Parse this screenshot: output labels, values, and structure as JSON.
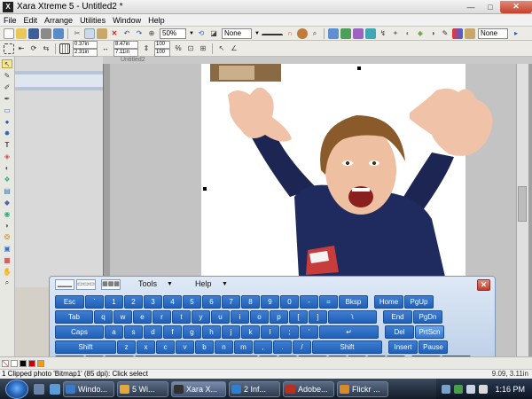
{
  "window": {
    "title": "Xara Xtreme 5 - Untitled2 *",
    "app_icon_glyph": "X",
    "minimize_glyph": "—",
    "maximize_glyph": "□",
    "close_glyph": "✕"
  },
  "menu": [
    "File",
    "Edit",
    "Arrange",
    "Utilities",
    "Window",
    "Help"
  ],
  "toolbar1": {
    "zoom_value": "50%",
    "fill_value": "None",
    "line_value": "None"
  },
  "toolbar2": {
    "x_value": "0.37in",
    "y_value": "2.31in",
    "w_value": "8.47in",
    "h_value": "7.11in",
    "scale_x": "100",
    "scale_y": "100",
    "scale_unit": "%"
  },
  "document": {
    "title": "Untitled2"
  },
  "status": {
    "left": "1 Clipped photo 'Bitmap1' (85 dpi): Click select",
    "right": "9.09, 3.11in"
  },
  "keyboard": {
    "modes": [
      "▁▁▁",
      "▭▭▭",
      "▦▦▦"
    ],
    "tools_label": "Tools",
    "help_label": "Help",
    "dropdown_glyph": "▼",
    "close_glyph": "✕",
    "rows": [
      [
        "Esc",
        "`",
        "1",
        "2",
        "3",
        "4",
        "5",
        "6",
        "7",
        "8",
        "9",
        "0",
        "-",
        "=",
        "Bksp",
        "Home",
        "PgUp"
      ],
      [
        "Tab",
        "q",
        "w",
        "e",
        "r",
        "t",
        "y",
        "u",
        "i",
        "o",
        "p",
        "[",
        "]",
        "\\",
        "End",
        "PgDn"
      ],
      [
        "Caps",
        "a",
        "s",
        "d",
        "f",
        "g",
        "h",
        "j",
        "k",
        "l",
        ";",
        "'",
        "↵",
        "Del",
        "PrtScn"
      ],
      [
        "Shift",
        "z",
        "x",
        "c",
        "v",
        "b",
        "n",
        "m",
        ",",
        ".",
        "/",
        "Shift",
        "Insert",
        "Pause"
      ],
      [
        "Ctrl",
        "⊞",
        "Alt",
        "",
        "Alt",
        "☰",
        "Ctrl",
        "↓",
        "↑",
        "←",
        "→",
        "Func",
        "ScLk"
      ]
    ]
  },
  "taskbar": {
    "buttons": [
      {
        "label": "Windo...",
        "color": "#3a78c8"
      },
      {
        "label": "5 Wi...",
        "color": "#e2a93a"
      },
      {
        "label": "Xara X...",
        "color": "#303030"
      },
      {
        "label": "2 Inf...",
        "color": "#2f7fd0"
      },
      {
        "label": "Adobe...",
        "color": "#b8311e"
      },
      {
        "label": "Flickr ...",
        "color": "#d88a2a"
      }
    ],
    "clock": "1:16 PM"
  },
  "colors": {
    "accent": "#1f5fb8",
    "titlebar_bg": "#e6e6e6"
  }
}
